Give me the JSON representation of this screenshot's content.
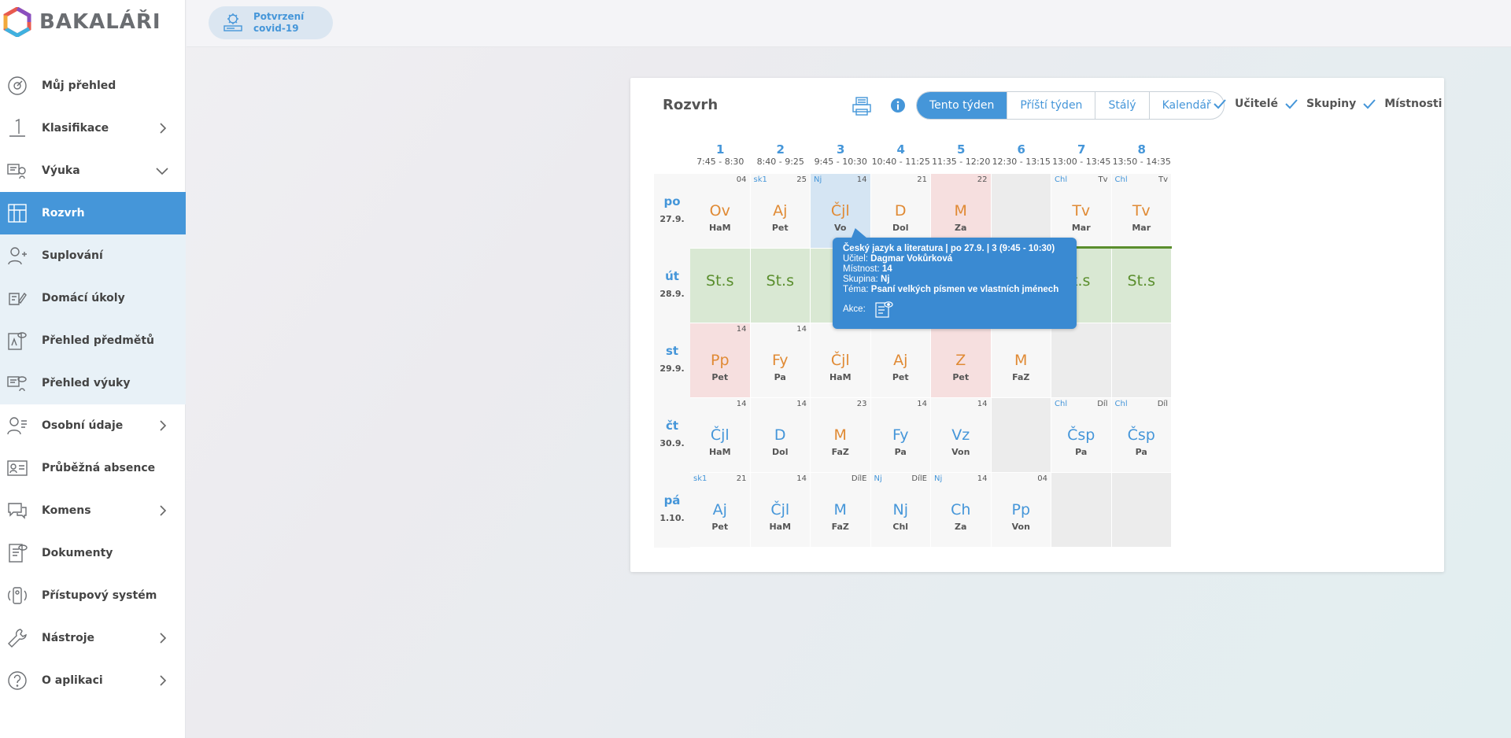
{
  "app": {
    "logo_text": "BAKALÁŘI"
  },
  "sidebar": {
    "items": [
      {
        "label": "Můj přehled",
        "icon": "gauge-icon"
      },
      {
        "label": "Klasifikace",
        "icon": "grade-icon",
        "arrow": "right"
      },
      {
        "label": "Výuka",
        "icon": "teaching-icon",
        "arrow": "down"
      },
      {
        "label": "Rozvrh",
        "icon": "timetable-icon",
        "active": true
      },
      {
        "label": "Suplování",
        "icon": "substitution-icon",
        "sub": true
      },
      {
        "label": "Domácí úkoly",
        "icon": "homework-icon",
        "sub": true
      },
      {
        "label": "Přehled předmětů",
        "icon": "subjects-icon",
        "sub": true
      },
      {
        "label": "Přehled výuky",
        "icon": "lessons-icon",
        "sub": true
      },
      {
        "label": "Osobní údaje",
        "icon": "person-icon",
        "arrow": "right"
      },
      {
        "label": "Průběžná absence",
        "icon": "absence-icon"
      },
      {
        "label": "Komens",
        "icon": "messages-icon",
        "arrow": "right"
      },
      {
        "label": "Dokumenty",
        "icon": "documents-icon"
      },
      {
        "label": "Přístupový systém",
        "icon": "access-icon"
      },
      {
        "label": "Nástroje",
        "icon": "wrench-icon",
        "arrow": "right"
      },
      {
        "label": "O aplikaci",
        "icon": "help-icon",
        "arrow": "right"
      }
    ]
  },
  "topbar": {
    "covid_label_1": "Potvrzení",
    "covid_label_2": "covid-19"
  },
  "card": {
    "title": "Rozvrh",
    "tabs": [
      "Tento týden",
      "Příští týden",
      "Stálý",
      "Kalendář"
    ],
    "active_tab": 0,
    "checks": [
      "Učitelé",
      "Skupiny",
      "Místnosti"
    ]
  },
  "timetable": {
    "hours": [
      {
        "num": "1",
        "time": "7:45 - 8:30"
      },
      {
        "num": "2",
        "time": "8:40 - 9:25"
      },
      {
        "num": "3",
        "time": "9:45 - 10:30"
      },
      {
        "num": "4",
        "time": "10:40 - 11:25"
      },
      {
        "num": "5",
        "time": "11:35 - 12:20"
      },
      {
        "num": "6",
        "time": "12:30 - 13:15"
      },
      {
        "num": "7",
        "time": "13:00 - 13:45"
      },
      {
        "num": "8",
        "time": "13:50 - 14:35"
      }
    ],
    "days": [
      {
        "name": "po",
        "date": "27.9."
      },
      {
        "name": "út",
        "date": "28.9."
      },
      {
        "name": "st",
        "date": "29.9."
      },
      {
        "name": "čt",
        "date": "30.9."
      },
      {
        "name": "pá",
        "date": "1.10."
      }
    ],
    "rows": [
      [
        {
          "subj": "Ov",
          "teach": "HaM",
          "tr": "04",
          "tl": "",
          "color": "orange",
          "bg": ""
        },
        {
          "subj": "Aj",
          "teach": "Pet",
          "tr": "25",
          "tl": "sk1",
          "color": "orange",
          "bg": ""
        },
        {
          "subj": "Čjl",
          "teach": "Vo",
          "tr": "14",
          "tl": "Nj",
          "color": "orange",
          "bg": "blue"
        },
        {
          "subj": "D",
          "teach": "Dol",
          "tr": "21",
          "tl": "",
          "color": "orange",
          "bg": ""
        },
        {
          "subj": "M",
          "teach": "Za",
          "tr": "22",
          "tl": "",
          "color": "orange",
          "bg": "pink"
        },
        {
          "empty": true
        },
        {
          "subj": "Tv",
          "teach": "Mar",
          "tr": "Tv",
          "tl": "Chl",
          "color": "orange",
          "bg": ""
        },
        {
          "subj": "Tv",
          "teach": "Mar",
          "tr": "Tv",
          "tl": "Chl",
          "color": "orange",
          "bg": ""
        }
      ],
      [
        {
          "subj": "St.s",
          "teach": "",
          "tr": "",
          "tl": "",
          "color": "",
          "bg": "green"
        },
        {
          "subj": "St.s",
          "teach": "",
          "tr": "",
          "tl": "",
          "color": "",
          "bg": "green"
        },
        {
          "subj": "S",
          "teach": "",
          "tr": "",
          "tl": "",
          "color": "",
          "bg": "green"
        },
        {
          "subj": "",
          "teach": "",
          "tr": "",
          "tl": "",
          "color": "",
          "bg": "green"
        },
        {
          "subj": "",
          "teach": "",
          "tr": "",
          "tl": "",
          "color": "",
          "bg": "green"
        },
        {
          "subj": "",
          "teach": "",
          "tr": "",
          "tl": "",
          "color": "",
          "bg": "green"
        },
        {
          "subj": "t.s",
          "teach": "",
          "tr": "",
          "tl": "",
          "color": "",
          "bg": "green"
        },
        {
          "subj": "St.s",
          "teach": "",
          "tr": "",
          "tl": "",
          "color": "",
          "bg": "green"
        }
      ],
      [
        {
          "subj": "Pp",
          "teach": "Pet",
          "tr": "14",
          "tl": "",
          "color": "orange",
          "bg": "pink"
        },
        {
          "subj": "Fy",
          "teach": "Pa",
          "tr": "14",
          "tl": "",
          "color": "orange",
          "bg": ""
        },
        {
          "subj": "Čjl",
          "teach": "HaM",
          "tr": "",
          "tl": "",
          "color": "orange",
          "bg": ""
        },
        {
          "subj": "Aj",
          "teach": "Pet",
          "tr": "",
          "tl": "",
          "color": "orange",
          "bg": ""
        },
        {
          "subj": "Z",
          "teach": "Pet",
          "tr": "",
          "tl": "",
          "color": "orange",
          "bg": "pink"
        },
        {
          "subj": "M",
          "teach": "FaZ",
          "tr": "",
          "tl": "",
          "color": "orange",
          "bg": ""
        },
        {
          "empty": true
        },
        {
          "empty": true
        }
      ],
      [
        {
          "subj": "Čjl",
          "teach": "HaM",
          "tr": "14",
          "tl": "",
          "color": "blue",
          "bg": ""
        },
        {
          "subj": "D",
          "teach": "Dol",
          "tr": "14",
          "tl": "",
          "color": "blue",
          "bg": ""
        },
        {
          "subj": "M",
          "teach": "FaZ",
          "tr": "23",
          "tl": "",
          "color": "orange",
          "bg": ""
        },
        {
          "subj": "Fy",
          "teach": "Pa",
          "tr": "14",
          "tl": "",
          "color": "blue",
          "bg": ""
        },
        {
          "subj": "Vz",
          "teach": "Von",
          "tr": "14",
          "tl": "",
          "color": "blue",
          "bg": ""
        },
        {
          "empty": true
        },
        {
          "subj": "Čsp",
          "teach": "Pa",
          "tr": "Díl",
          "tl": "Chl",
          "color": "blue",
          "bg": ""
        },
        {
          "subj": "Čsp",
          "teach": "Pa",
          "tr": "Díl",
          "tl": "Chl",
          "color": "blue",
          "bg": ""
        }
      ],
      [
        {
          "subj": "Aj",
          "teach": "Pet",
          "tr": "21",
          "tl": "sk1",
          "color": "blue",
          "bg": ""
        },
        {
          "subj": "Čjl",
          "teach": "HaM",
          "tr": "14",
          "tl": "",
          "color": "blue",
          "bg": ""
        },
        {
          "subj": "M",
          "teach": "FaZ",
          "tr": "DílE",
          "tl": "",
          "color": "blue",
          "bg": ""
        },
        {
          "subj": "Nj",
          "teach": "Chl",
          "tr": "DílE",
          "tl": "Nj",
          "color": "blue",
          "bg": ""
        },
        {
          "subj": "Ch",
          "teach": "Za",
          "tr": "14",
          "tl": "Nj",
          "color": "blue",
          "bg": ""
        },
        {
          "subj": "Pp",
          "teach": "Von",
          "tr": "04",
          "tl": "",
          "color": "blue",
          "bg": ""
        },
        {
          "empty": true
        },
        {
          "empty": true
        }
      ]
    ]
  },
  "tooltip": {
    "title": "Český jazyk a literatura | po 27.9. | 3 (9:45 - 10:30)",
    "teacher_label": "Učitel:",
    "teacher": "Dagmar Vokůrková",
    "room_label": "Místnost:",
    "room": "14",
    "group_label": "Skupina:",
    "group": "Nj",
    "topic_label": "Téma:",
    "topic": "Psaní velkých písmen ve vlastních jménech",
    "actions_label": "Akce:"
  }
}
